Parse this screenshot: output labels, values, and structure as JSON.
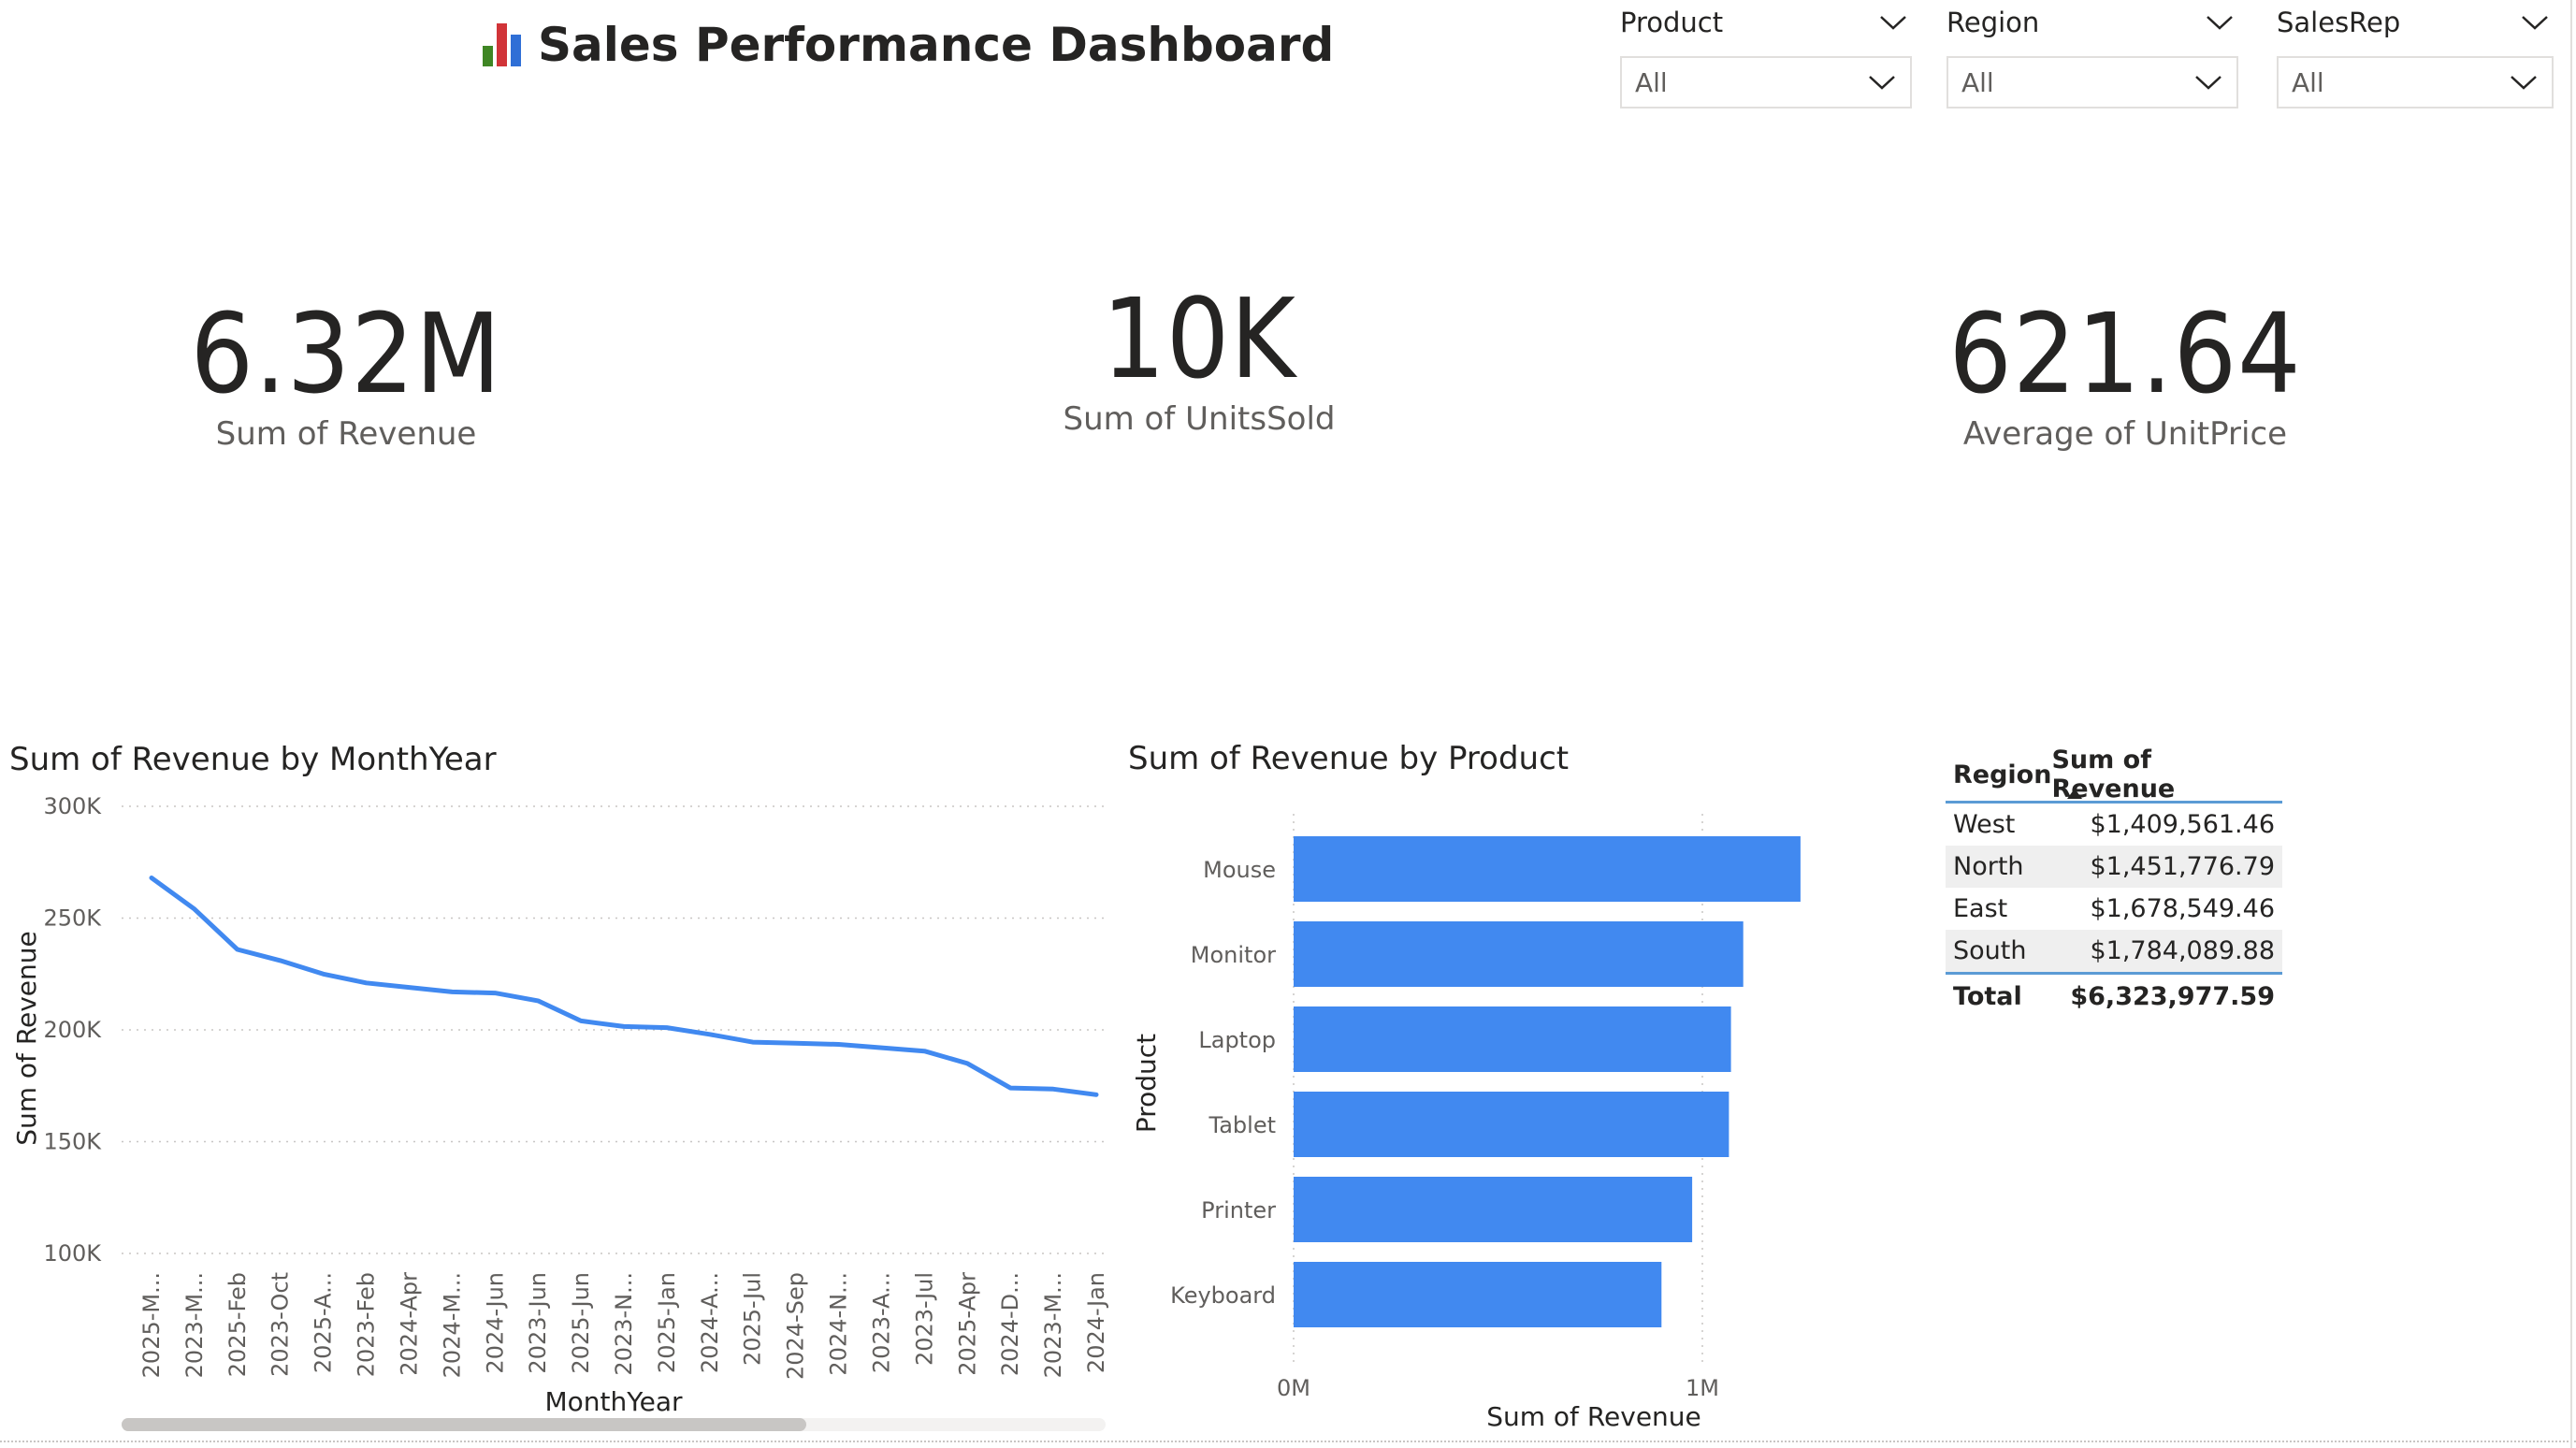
{
  "header": {
    "title": "Sales Performance Dashboard",
    "icon": "bar-chart-emoji-icon",
    "icon_colors": [
      "#3f8624",
      "#d13438",
      "#2f6fd6"
    ]
  },
  "slicers": [
    {
      "label": "Product",
      "value": "All"
    },
    {
      "label": "Region",
      "value": "All"
    },
    {
      "label": "SalesRep",
      "value": "All"
    }
  ],
  "kpis": [
    {
      "value": "6.32M",
      "label": "Sum of Revenue"
    },
    {
      "value": "10K",
      "label": "Sum of UnitsSold"
    },
    {
      "value": "621.64",
      "label": "Average of UnitPrice"
    }
  ],
  "line_chart": {
    "title": "Sum of Revenue by MonthYear"
  },
  "bar_chart": {
    "title": "Sum of Revenue by Product"
  },
  "table": {
    "headers": [
      "Region",
      "Sum of Revenue"
    ],
    "rows": [
      {
        "region": "West",
        "revenue": "$1,409,561.46"
      },
      {
        "region": "North",
        "revenue": "$1,451,776.79"
      },
      {
        "region": "East",
        "revenue": "$1,678,549.46"
      },
      {
        "region": "South",
        "revenue": "$1,784,089.88"
      }
    ],
    "total_label": "Total",
    "total_value": "$6,323,977.59"
  },
  "colors": {
    "series": "#4189f0",
    "accent": "#5b9bd5"
  },
  "chart_data": [
    {
      "type": "line",
      "title": "Sum of Revenue by MonthYear",
      "xlabel": "MonthYear",
      "ylabel": "Sum of Revenue",
      "x": [
        "2025-M...",
        "2023-M...",
        "2025-Feb",
        "2023-Oct",
        "2025-A...",
        "2023-Feb",
        "2024-Apr",
        "2024-M...",
        "2024-Jun",
        "2023-Jun",
        "2025-Jun",
        "2023-N...",
        "2025-Jan",
        "2024-A...",
        "2025-Jul",
        "2024-Sep",
        "2024-N...",
        "2023-A...",
        "2023-Jul",
        "2025-Apr",
        "2024-D...",
        "2023-M...",
        "2024-Jan"
      ],
      "series": [
        {
          "values": [
            268000,
            254000,
            236000,
            231000,
            225000,
            221000,
            219000,
            217000,
            216500,
            213000,
            204000,
            201500,
            201000,
            198000,
            194500,
            194000,
            193500,
            192000,
            190500,
            185000,
            174000,
            173500,
            171000
          ]
        }
      ],
      "yticks": [
        "100K",
        "150K",
        "200K",
        "250K",
        "300K"
      ],
      "ylim": [
        100000,
        300000
      ],
      "grid": true
    },
    {
      "type": "bar",
      "orientation": "horizontal",
      "title": "Sum of Revenue by Product",
      "xlabel": "Sum of Revenue",
      "ylabel": "Product",
      "categories": [
        "Mouse",
        "Monitor",
        "Laptop",
        "Tablet",
        "Printer",
        "Keyboard"
      ],
      "values": [
        1240000,
        1100000,
        1070000,
        1065000,
        975000,
        900000
      ],
      "xticks": [
        "0M",
        "1M"
      ],
      "xlim": [
        0,
        1000000
      ],
      "grid": true
    }
  ]
}
